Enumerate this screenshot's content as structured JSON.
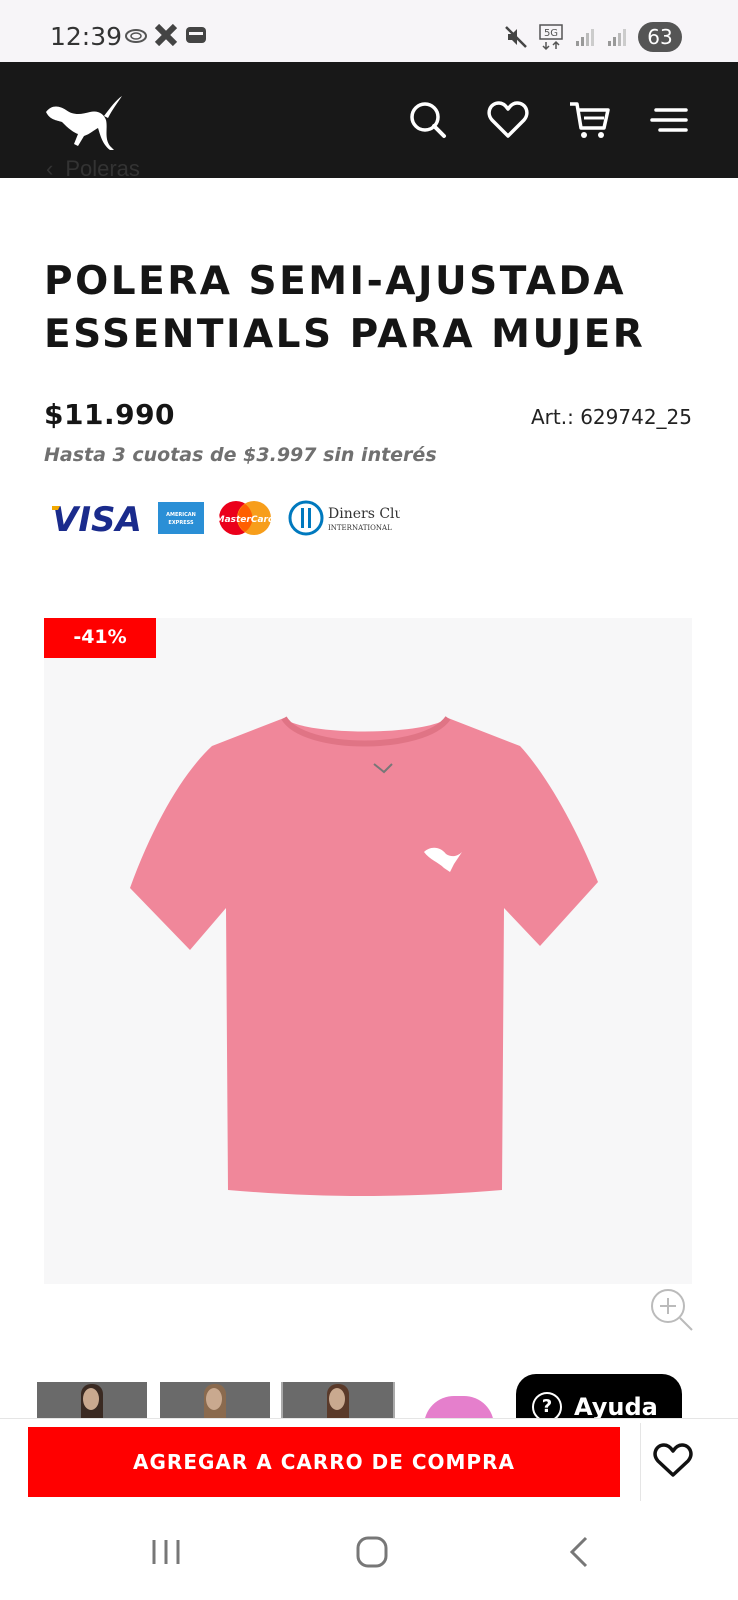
{
  "status_bar": {
    "time": "12:39",
    "network": "5G",
    "battery": "63"
  },
  "header": {
    "logo": "puma-logo",
    "icons": [
      "search-icon",
      "heart-icon",
      "cart-icon",
      "menu-icon"
    ]
  },
  "breadcrumb": {
    "label": "Poleras"
  },
  "product": {
    "title": "POLERA SEMI-AJUSTADA ESSENTIALS PARA MUJER",
    "price": "$11.990",
    "article": "Art.: 629742_25",
    "installments": "Hasta 3 cuotas de $3.997 sin interés",
    "discount_badge": "-41%",
    "shirt_color": "#f0879a"
  },
  "payment_cards": {
    "visa": "VISA",
    "amex": "AMERICAN EXPRESS",
    "mastercard": "MasterCard",
    "diners_line1": "Diners Club",
    "diners_line2": "INTERNATIONAL"
  },
  "help": {
    "label": "Ayuda"
  },
  "actions": {
    "add_to_cart": "AGREGAR A CARRO DE COMPRA"
  },
  "colors": {
    "accent": "#ff0000",
    "header_bg": "#181818"
  }
}
